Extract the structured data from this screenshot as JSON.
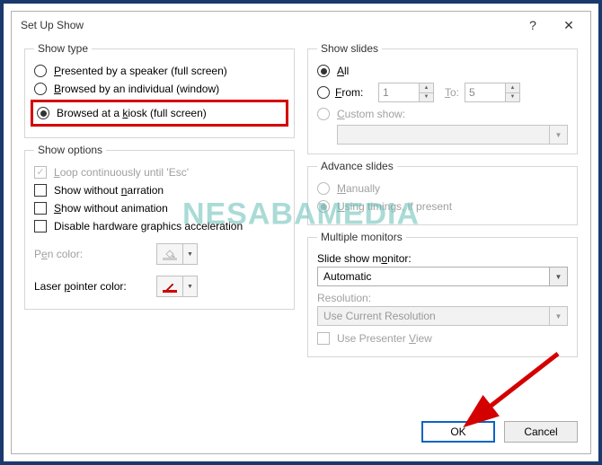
{
  "title": "Set Up Show",
  "help_symbol": "?",
  "close_symbol": "✕",
  "watermark": "NESABAMEDIA",
  "show_type": {
    "legend": "Show type",
    "items": [
      {
        "label_pre": "",
        "accel": "P",
        "label_post": "resented by a speaker (full screen)"
      },
      {
        "label_pre": "",
        "accel": "B",
        "label_post": "rowsed by an individual (window)"
      },
      {
        "label_pre": "Browsed at a ",
        "accel": "k",
        "label_post": "iosk (full screen)"
      }
    ],
    "selected": 2
  },
  "show_options": {
    "legend": "Show options",
    "loop": {
      "label_pre": "",
      "accel": "L",
      "label_post": "oop continuously until 'Esc'"
    },
    "narration": {
      "label_pre": "Show without ",
      "accel": "n",
      "label_post": "arration"
    },
    "animation": {
      "label_pre": "",
      "accel": "S",
      "label_post": "how without animation"
    },
    "hwaccel": {
      "label_pre": "Disable hardware ",
      "accel": "g",
      "label_post": "raphics acceleration"
    },
    "pen_label_pre": "P",
    "pen_accel": "e",
    "pen_label_post": "n color:",
    "laser_label_pre": "Laser ",
    "laser_accel": "p",
    "laser_label_post": "ointer color:"
  },
  "show_slides": {
    "legend": "Show slides",
    "all": {
      "accel": "A",
      "label_post": "ll"
    },
    "from": {
      "accel": "F",
      "label_post": "rom:"
    },
    "to_pre": "",
    "to_accel": "T",
    "to_post": "o:",
    "from_val": "1",
    "to_val": "5",
    "custom": {
      "accel": "C",
      "label_post": "ustom show:"
    },
    "selected": 0
  },
  "advance": {
    "legend": "Advance slides",
    "manual": {
      "accel": "M",
      "label_post": "anually"
    },
    "timings": {
      "pre": "",
      "accel": "U",
      "post": "sing timings, if present"
    }
  },
  "monitors": {
    "legend": "Multiple monitors",
    "monitor_label_pre": "Slide show m",
    "monitor_accel": "o",
    "monitor_label_post": "nitor:",
    "monitor_value": "Automatic",
    "res_label": "Resolution:",
    "res_value": "Use Current Resolution",
    "presenter_pre": "Use Presenter ",
    "presenter_accel": "V",
    "presenter_post": "iew"
  },
  "buttons": {
    "ok": "OK",
    "cancel": "Cancel"
  }
}
